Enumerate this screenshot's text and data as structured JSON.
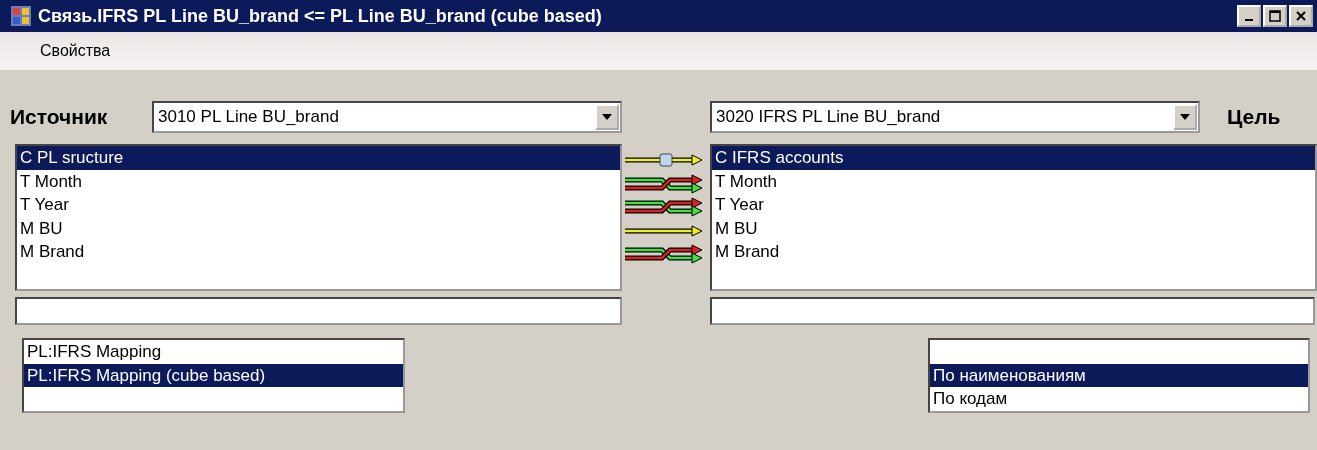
{
  "window": {
    "title": "Связь.IFRS PL Line BU_brand <= PL Line BU_brand (cube based)"
  },
  "menu": [
    "Свойства"
  ],
  "source": {
    "label": "Источник",
    "combo": "3010 PL Line BU_brand",
    "items": [
      {
        "text": "C PL sructure",
        "selected": true
      },
      {
        "text": "T Month",
        "selected": false
      },
      {
        "text": "T Year",
        "selected": false
      },
      {
        "text": "M BU",
        "selected": false
      },
      {
        "text": "M Brand",
        "selected": false
      }
    ]
  },
  "links": [
    {
      "kind": "node"
    },
    {
      "kind": "crossed"
    },
    {
      "kind": "crossed"
    },
    {
      "kind": "plain"
    },
    {
      "kind": "crossed"
    }
  ],
  "target": {
    "label": "Цель",
    "combo": "3020 IFRS PL Line BU_brand",
    "items": [
      {
        "text": "C IFRS accounts",
        "selected": true
      },
      {
        "text": "T Month",
        "selected": false
      },
      {
        "text": "T Year",
        "selected": false
      },
      {
        "text": "M BU",
        "selected": false
      },
      {
        "text": "M Brand",
        "selected": false
      }
    ]
  },
  "mappings": [
    {
      "text": "PL:IFRS Mapping",
      "selected": false
    },
    {
      "text": "PL:IFRS Mapping (cube based)",
      "selected": true
    }
  ],
  "match_modes": [
    {
      "text": "По наименованиям",
      "selected": true
    },
    {
      "text": "По кодам",
      "selected": false
    }
  ]
}
